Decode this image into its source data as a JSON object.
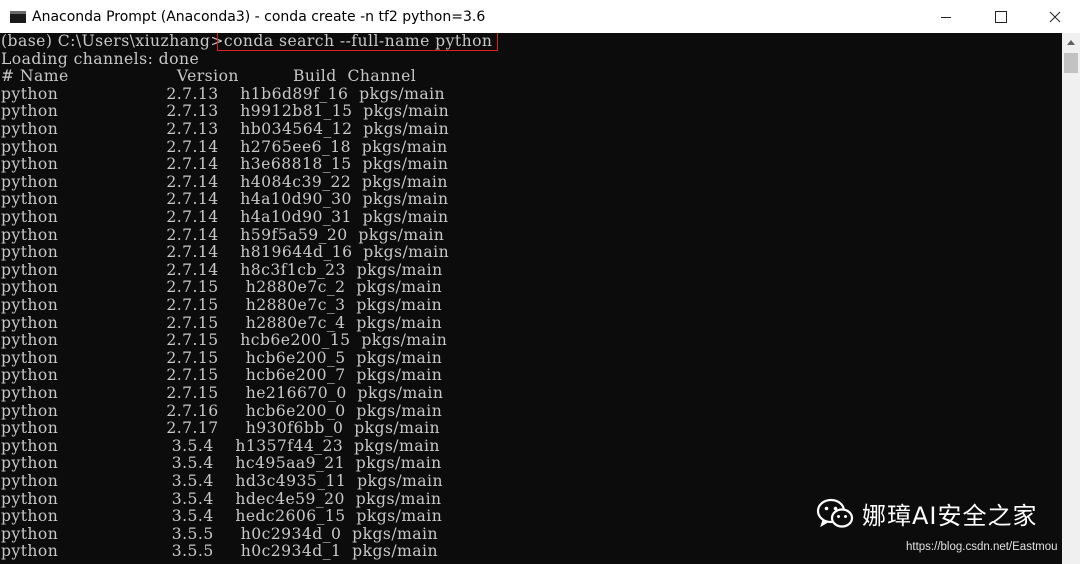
{
  "window": {
    "title": "Anaconda Prompt (Anaconda3) - conda  create -n tf2 python=3.6",
    "icon": "console-icon"
  },
  "console": {
    "prompt": "(base) C:\\Users\\xiuzhang>",
    "command": "conda search --full-name python",
    "status": "Loading channels: done",
    "header": {
      "name": "# Name",
      "version": "Version",
      "build": "Build",
      "channel": "Channel"
    },
    "rows": [
      {
        "name": "python",
        "version": "2.7.13",
        "build": "h1b6d89f_16",
        "channel": "pkgs/main"
      },
      {
        "name": "python",
        "version": "2.7.13",
        "build": "h9912b81_15",
        "channel": "pkgs/main"
      },
      {
        "name": "python",
        "version": "2.7.13",
        "build": "hb034564_12",
        "channel": "pkgs/main"
      },
      {
        "name": "python",
        "version": "2.7.14",
        "build": "h2765ee6_18",
        "channel": "pkgs/main"
      },
      {
        "name": "python",
        "version": "2.7.14",
        "build": "h3e68818_15",
        "channel": "pkgs/main"
      },
      {
        "name": "python",
        "version": "2.7.14",
        "build": "h4084c39_22",
        "channel": "pkgs/main"
      },
      {
        "name": "python",
        "version": "2.7.14",
        "build": "h4a10d90_30",
        "channel": "pkgs/main"
      },
      {
        "name": "python",
        "version": "2.7.14",
        "build": "h4a10d90_31",
        "channel": "pkgs/main"
      },
      {
        "name": "python",
        "version": "2.7.14",
        "build": "h59f5a59_20",
        "channel": "pkgs/main"
      },
      {
        "name": "python",
        "version": "2.7.14",
        "build": "h819644d_16",
        "channel": "pkgs/main"
      },
      {
        "name": "python",
        "version": "2.7.14",
        "build": "h8c3f1cb_23",
        "channel": "pkgs/main"
      },
      {
        "name": "python",
        "version": "2.7.15",
        "build": "h2880e7c_2",
        "channel": "pkgs/main"
      },
      {
        "name": "python",
        "version": "2.7.15",
        "build": "h2880e7c_3",
        "channel": "pkgs/main"
      },
      {
        "name": "python",
        "version": "2.7.15",
        "build": "h2880e7c_4",
        "channel": "pkgs/main"
      },
      {
        "name": "python",
        "version": "2.7.15",
        "build": "hcb6e200_15",
        "channel": "pkgs/main"
      },
      {
        "name": "python",
        "version": "2.7.15",
        "build": "hcb6e200_5",
        "channel": "pkgs/main"
      },
      {
        "name": "python",
        "version": "2.7.15",
        "build": "hcb6e200_7",
        "channel": "pkgs/main"
      },
      {
        "name": "python",
        "version": "2.7.15",
        "build": "he216670_0",
        "channel": "pkgs/main"
      },
      {
        "name": "python",
        "version": "2.7.16",
        "build": "hcb6e200_0",
        "channel": "pkgs/main"
      },
      {
        "name": "python",
        "version": "2.7.17",
        "build": "h930f6bb_0",
        "channel": "pkgs/main"
      },
      {
        "name": "python",
        "version": "3.5.4",
        "build": "h1357f44_23",
        "channel": "pkgs/main"
      },
      {
        "name": "python",
        "version": "3.5.4",
        "build": "hc495aa9_21",
        "channel": "pkgs/main"
      },
      {
        "name": "python",
        "version": "3.5.4",
        "build": "hd3c4935_11",
        "channel": "pkgs/main"
      },
      {
        "name": "python",
        "version": "3.5.4",
        "build": "hdec4e59_20",
        "channel": "pkgs/main"
      },
      {
        "name": "python",
        "version": "3.5.4",
        "build": "hedc2606_15",
        "channel": "pkgs/main"
      },
      {
        "name": "python",
        "version": "3.5.5",
        "build": "h0c2934d_0",
        "channel": "pkgs/main"
      },
      {
        "name": "python",
        "version": "3.5.5",
        "build": "h0c2934d_1",
        "channel": "pkgs/main"
      }
    ]
  },
  "watermark": {
    "text": "娜璋AI安全之家",
    "url": "https://blog.csdn.net/Eastmou"
  },
  "colors": {
    "console_bg": "#0c0c0c",
    "console_text": "#c8c8c8",
    "highlight_box": "#e01e1e"
  }
}
